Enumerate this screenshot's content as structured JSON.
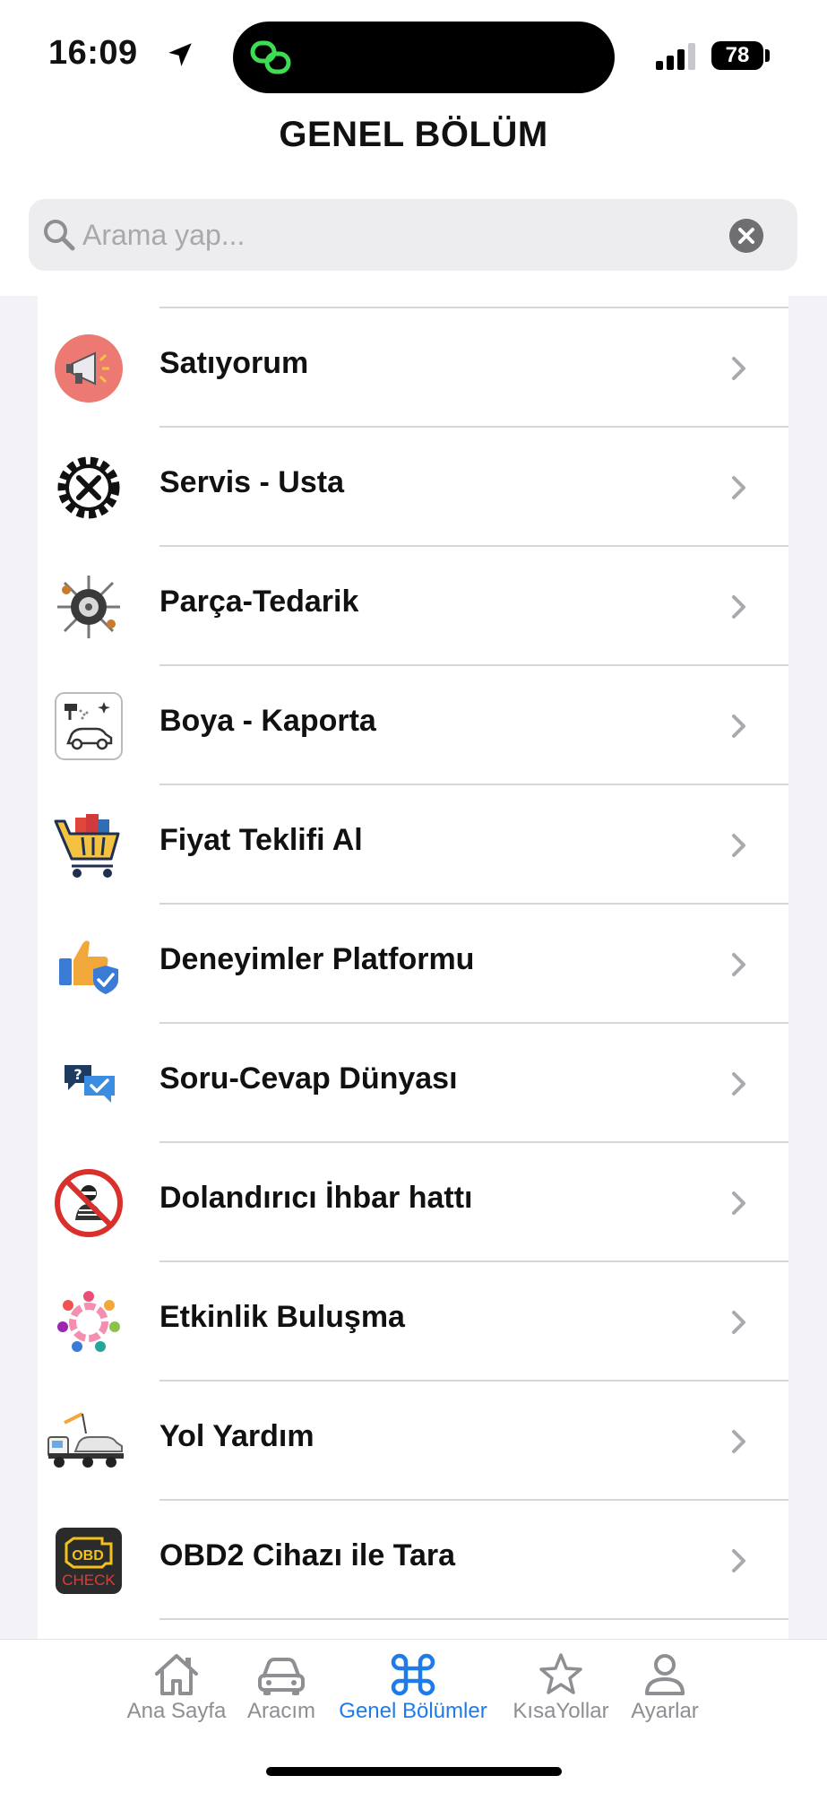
{
  "status_bar": {
    "time": "16:09",
    "battery": "78"
  },
  "header": {
    "title": "GENEL BÖLÜM"
  },
  "search": {
    "placeholder": "Arama yap..."
  },
  "items": [
    {
      "label": "Satıyorum",
      "icon": "megaphone-icon"
    },
    {
      "label": "Servis - Usta",
      "icon": "wrench-gear-icon"
    },
    {
      "label": "Parça-Tedarik",
      "icon": "car-parts-icon"
    },
    {
      "label": "Boya - Kaporta",
      "icon": "spray-paint-car-icon"
    },
    {
      "label": "Fiyat Teklifi Al",
      "icon": "shopping-cart-icon"
    },
    {
      "label": "Deneyimler Platformu",
      "icon": "thumbs-up-shield-icon"
    },
    {
      "label": "Soru-Cevap Dünyası",
      "icon": "chat-question-icon"
    },
    {
      "label": "Dolandırıcı İhbar hattı",
      "icon": "no-thief-icon"
    },
    {
      "label": "Etkinlik Buluşma",
      "icon": "community-circle-icon"
    },
    {
      "label": "Yol Yardım",
      "icon": "tow-truck-icon"
    },
    {
      "label": "OBD2 Cihazı ile Tara",
      "icon": "obd-check-icon"
    }
  ],
  "obd_icon_text": {
    "top": "OBD",
    "bottom": "CHECK"
  },
  "tabs": [
    {
      "label": "Ana Sayfa",
      "icon": "home-icon",
      "active": false
    },
    {
      "label": "Aracım",
      "icon": "car-icon",
      "active": false
    },
    {
      "label": "Genel Bölümler",
      "icon": "command-icon",
      "active": true
    },
    {
      "label": "KısaYollar",
      "icon": "star-icon",
      "active": false
    },
    {
      "label": "Ayarlar",
      "icon": "person-icon",
      "active": false
    }
  ],
  "colors": {
    "accent": "#1f7be8",
    "inactive": "#8e8e93",
    "background": "#f2f2f7"
  }
}
